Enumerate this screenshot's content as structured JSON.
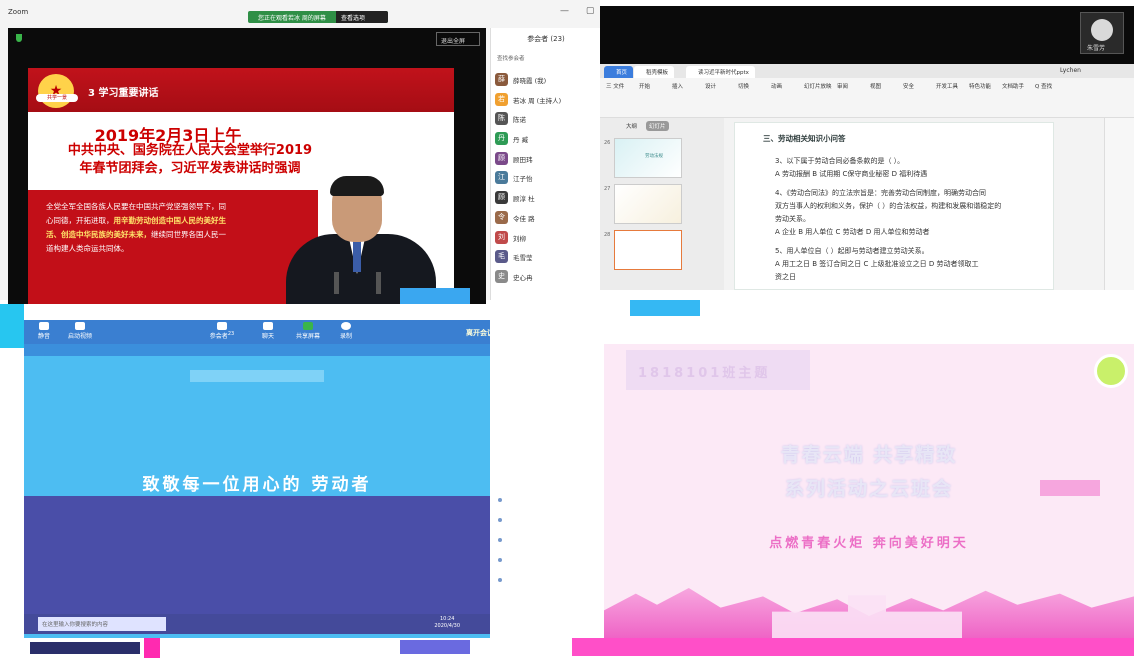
{
  "zoom": {
    "title": "Zoom",
    "banner_text": "您正在观看若冰 周的屏幕",
    "banner_button": "查看选项",
    "fullscreen_label": "退出全屏",
    "slide": {
      "emblem_text": "★",
      "emblem_label": "共学一景",
      "heading": "3 学习重要讲话",
      "date": "2019年2月3日上午",
      "headline_line1": "中共中央、国务院在人民大会堂举行2019",
      "headline_line2": "年春节团拜会，习近平发表讲话时强调",
      "body_line1": "全党全军全国各族人民要在中国共产党坚强领导下，同",
      "body_line2_a": "心同德，开拓进取，",
      "body_line2_b": "用辛勤劳动创造中国人民的美好生",
      "body_line3": "活、创造中华民族的美好未来，",
      "body_line3_b": "继续同世界各国人民一",
      "body_line4": "道构建人类命运共同体。"
    },
    "participants": {
      "title": "参会者 (23)",
      "search_placeholder": "查找参会者",
      "list": [
        {
          "initial": "薛",
          "name": "薛晓霞 (我)",
          "color": "#8a5a3c"
        },
        {
          "initial": "若",
          "name": "若冰 周 (主持人)",
          "color": "#f0a030"
        },
        {
          "initial": "陈",
          "name": "陈诺",
          "color": "#555555"
        },
        {
          "initial": "丹",
          "name": "丹 臧",
          "color": "#2e9b55"
        },
        {
          "initial": "顾",
          "name": "顾田玮",
          "color": "#7b4a8a"
        },
        {
          "initial": "江",
          "name": "江子怡",
          "color": "#4a7a9a"
        },
        {
          "initial": "顾",
          "name": "顾淳 杜",
          "color": "#3a3a3a"
        },
        {
          "initial": "令",
          "name": "令佳 路",
          "color": "#9a6a4a"
        },
        {
          "initial": "刘",
          "name": "刘柳",
          "color": "#c04a4a"
        },
        {
          "initial": "毛",
          "name": "毛雪莹",
          "color": "#5a5a8a"
        },
        {
          "initial": "史",
          "name": "史心冉",
          "color": "#8a8a8a"
        }
      ]
    },
    "toolbar": {
      "mute_label": "静音",
      "video_label": "启动视频",
      "participants_label": "参会者",
      "participants_count": "23",
      "chat_label": "聊天",
      "share_label": "共享屏幕",
      "record_label": "录制",
      "leave_label": "离开会议"
    }
  },
  "ppt": {
    "tab_home": "首页",
    "tab_template": "稻壳模板",
    "tab_file": "读习近平新时代pptx",
    "user_name": "Lychen",
    "menu": [
      "三 文件",
      "开始",
      "插入",
      "设计",
      "切换",
      "动画",
      "幻灯片放映",
      "审阅",
      "视图",
      "安全",
      "开发工具",
      "特色功能",
      "文档助手",
      "Q 查找"
    ],
    "panel_tabs": [
      "大纲",
      "幻灯片"
    ],
    "thumb_numbers": [
      "26",
      "27",
      "28"
    ],
    "thumb26_text": "劳动法规",
    "question_title": "三、劳动相关知识小问答",
    "q3": "3、以下属于劳动合同必备条款的是（  ）。",
    "q3_opts": "A 劳动报酬  B 试用期  C保守商业秘密  D 福利待遇",
    "q4_line1": "4、《劳动合同法》的立法宗旨是：完善劳动合同制度，明确劳动合同",
    "q4_line2": "双方当事人的权利和义务，保护（  ）的合法权益，构建和发展和谐稳定的",
    "q4_line3": "劳动关系。",
    "q4_opts": "A 企业   B 用人单位  C 劳动者  D 用人单位和劳动者",
    "q5": "5、用人单位自（  ）起即与劳动者建立劳动关系。",
    "q5_opts": "A 用工之日  B 签订合同之日  C 上级批准设立之日  D 劳动者领取工",
    "q5_cont": "资之日",
    "camera_name": "朱雪芳"
  },
  "blue_screen": {
    "greeting": "致敬每一位用心的   劳动者",
    "search_placeholder": "在这里输入你要搜索的内容",
    "clock_time": "10:24",
    "clock_date": "2020/4/30"
  },
  "pink_screen": {
    "badge_text": "1818101班主题",
    "title_line1": "青春云端 共享精致",
    "title_line2": "系列活动之云班会",
    "slogan": "点燃青春火炬   奔向美好明天"
  }
}
